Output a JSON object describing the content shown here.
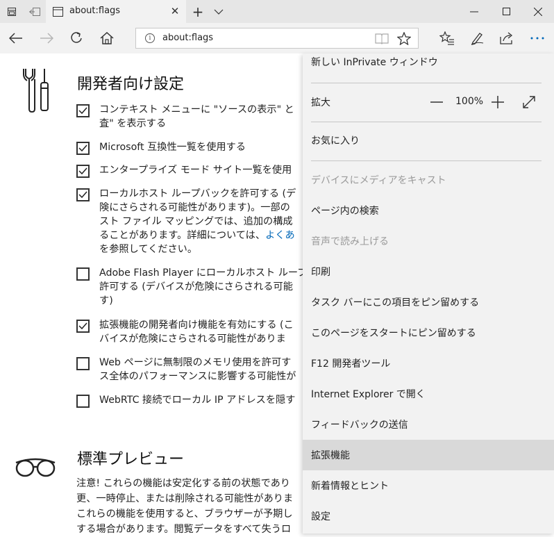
{
  "tab": {
    "title": "about:flags"
  },
  "address": {
    "url": "about:flags"
  },
  "sections": {
    "dev_title": "開発者向け設定",
    "preview_title": "標準プレビュー"
  },
  "options": [
    {
      "text": "コンテキスト メニューに \"ソースの表示\" と\n査\" を表示する",
      "checked": true
    },
    {
      "text": "Microsoft 互換性一覧を使用する",
      "checked": true
    },
    {
      "text": "エンタープライズ モード サイト一覧を使用",
      "checked": true
    },
    {
      "text": "ローカルホスト ループバックを許可する (デ\n険にさらされる可能性があります)。一部の\nスト ファイル マッピングでは、追加の構成\nることがあります。詳細については、",
      "link": "よくあ",
      "text_after": "\nを参照してください。",
      "checked": true
    },
    {
      "text": "Adobe Flash Player にローカルホスト ループ\n許可する (デバイスが危険にさらされる可能\nす)",
      "checked": false
    },
    {
      "text": "拡張機能の開発者向け機能を有効にする (こ\nバイスが危険にさらされる可能性がありま",
      "checked": true
    },
    {
      "text": "Web ページに無制限のメモリ使用を許可す\nス全体のパフォーマンスに影響する可能性が",
      "checked": false
    },
    {
      "text": "WebRTC 接続でローカル IP アドレスを隠す",
      "checked": false
    }
  ],
  "preview_text": "注意! これらの機能は安定化する前の状態であり\n更、一時停止、または削除される可能性がありま\nこれらの機能を使用すると、ブラウザーが予期し\nする場合があります。閲覧データをすべて失うロ",
  "menu": {
    "inprivate": "新しい InPrivate ウィンドウ",
    "zoom_label": "拡大",
    "zoom_value": "100%",
    "favorites": "お気に入り",
    "cast": "デバイスにメディアをキャスト",
    "find": "ページ内の検索",
    "read_aloud": "音声で読み上げる",
    "print": "印刷",
    "pin_taskbar": "タスク バーにこの項目をピン留めする",
    "pin_start": "このページをスタートにピン留めする",
    "devtools": "F12 開発者ツール",
    "open_ie": "Internet Explorer で開く",
    "feedback": "フィードバックの送信",
    "extensions": "拡張機能",
    "whats_new": "新着情報とヒント",
    "settings": "設定"
  }
}
